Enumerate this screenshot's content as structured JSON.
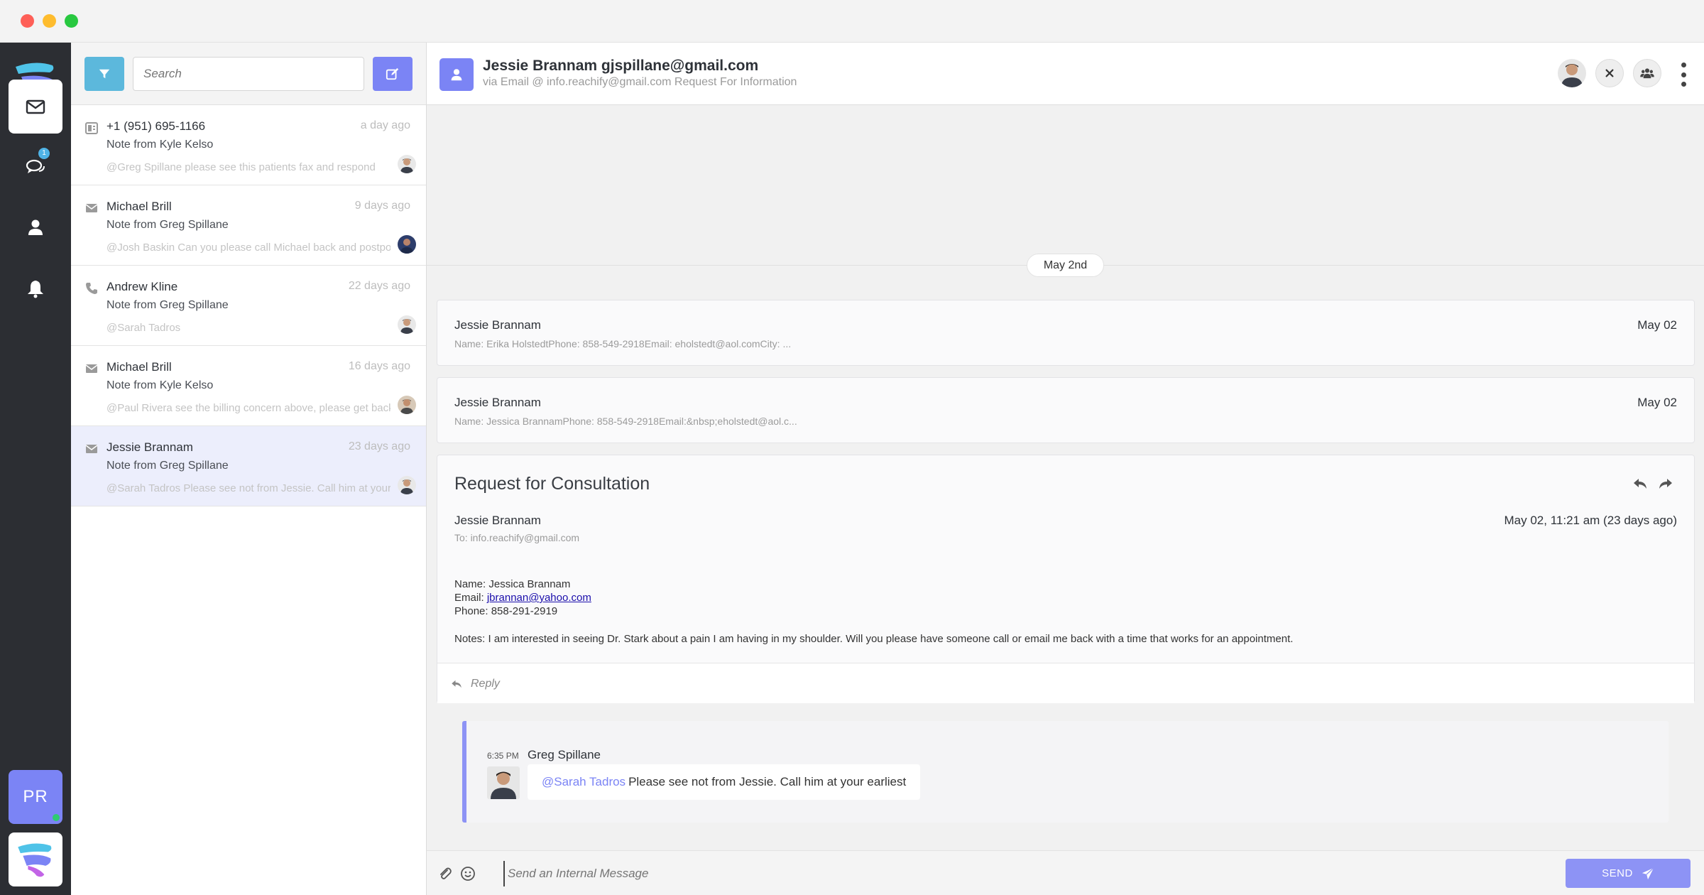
{
  "window": {
    "traffic_lights": [
      "close",
      "minimize",
      "zoom"
    ]
  },
  "rail": {
    "items": [
      {
        "name": "inbox",
        "icon": "envelope-icon",
        "active": true
      },
      {
        "name": "chat",
        "icon": "chat-bubbles-icon",
        "badge": "1"
      },
      {
        "name": "contacts",
        "icon": "user-icon"
      },
      {
        "name": "notifications",
        "icon": "bell-icon"
      }
    ],
    "user_initials": "PR",
    "online_color": "#2ecc71"
  },
  "list": {
    "search_placeholder": "Search",
    "conversations": [
      {
        "icon": "fax-icon",
        "name": "+1 (951) 695-1166",
        "time": "a day ago",
        "subtitle": "Note from Kyle Kelso",
        "preview": "@Greg Spillane please see this patients fax and respond"
      },
      {
        "icon": "envelope-icon",
        "name": "Michael Brill",
        "time": "9 days ago",
        "subtitle": "Note from Greg Spillane",
        "preview": "@Josh Baskin Can you please call Michael back and postpone"
      },
      {
        "icon": "phone-icon",
        "name": "Andrew Kline",
        "time": "22 days ago",
        "subtitle": "Note from Greg Spillane",
        "preview": "@Sarah Tadros"
      },
      {
        "icon": "envelope-icon",
        "name": "Michael Brill",
        "time": "16 days ago",
        "subtitle": "Note from Kyle Kelso",
        "preview": "@Paul Rivera see the billing concern above, please get back"
      },
      {
        "icon": "envelope-icon",
        "name": "Jessie Brannam",
        "time": "23 days ago",
        "subtitle": "Note from Greg Spillane",
        "preview": "@Sarah Tadros Please see not from Jessie. Call him at your earliest",
        "selected": true
      }
    ]
  },
  "header": {
    "title": "Jessie Brannam gjspillane@gmail.com",
    "subtitle": "via Email @ info.reachify@gmail.com Request For Information"
  },
  "thread": {
    "date_divider": "May 2nd",
    "messages": [
      {
        "from": "Jessie Brannam",
        "date": "May 02",
        "preview": "Name: Erika HolstedtPhone: 858-549-2918Email: eholstedt@aol.comCity: ..."
      },
      {
        "from": "Jessie Brannam",
        "date": "May 02",
        "preview": "Name: Jessica BrannamPhone: 858-549-2918Email:&nbsp;eholstedt@aol.c..."
      }
    ],
    "email": {
      "subject": "Request for Consultation",
      "from": "Jessie Brannam",
      "to": "To: info.reachify@gmail.com",
      "date": "May 02, 11:21 am (23 days ago)",
      "name_line": "Name: Jessica Brannam",
      "email_label": "Email: ",
      "email_link": "jbrannan@yahoo.com",
      "phone_line": "Phone: 858-291-2919",
      "notes": "Notes: I am interested in seeing Dr. Stark about a pain I am having in my shoulder. Will you please have someone call or email me back with a time that works for an appointment.",
      "reply_label": "Reply"
    },
    "note": {
      "time": "6:35 PM",
      "author": "Greg Spillane",
      "mention": "@Sarah Tadros",
      "text": "Please see not from Jessie. Call him at your earliest"
    }
  },
  "composer": {
    "placeholder": "Send an Internal Message",
    "send_label": "SEND"
  },
  "colors": {
    "accent": "#7b84f5",
    "filter": "#5cb8dc",
    "rail": "#2c2e33",
    "selected_row": "#eceefc"
  }
}
